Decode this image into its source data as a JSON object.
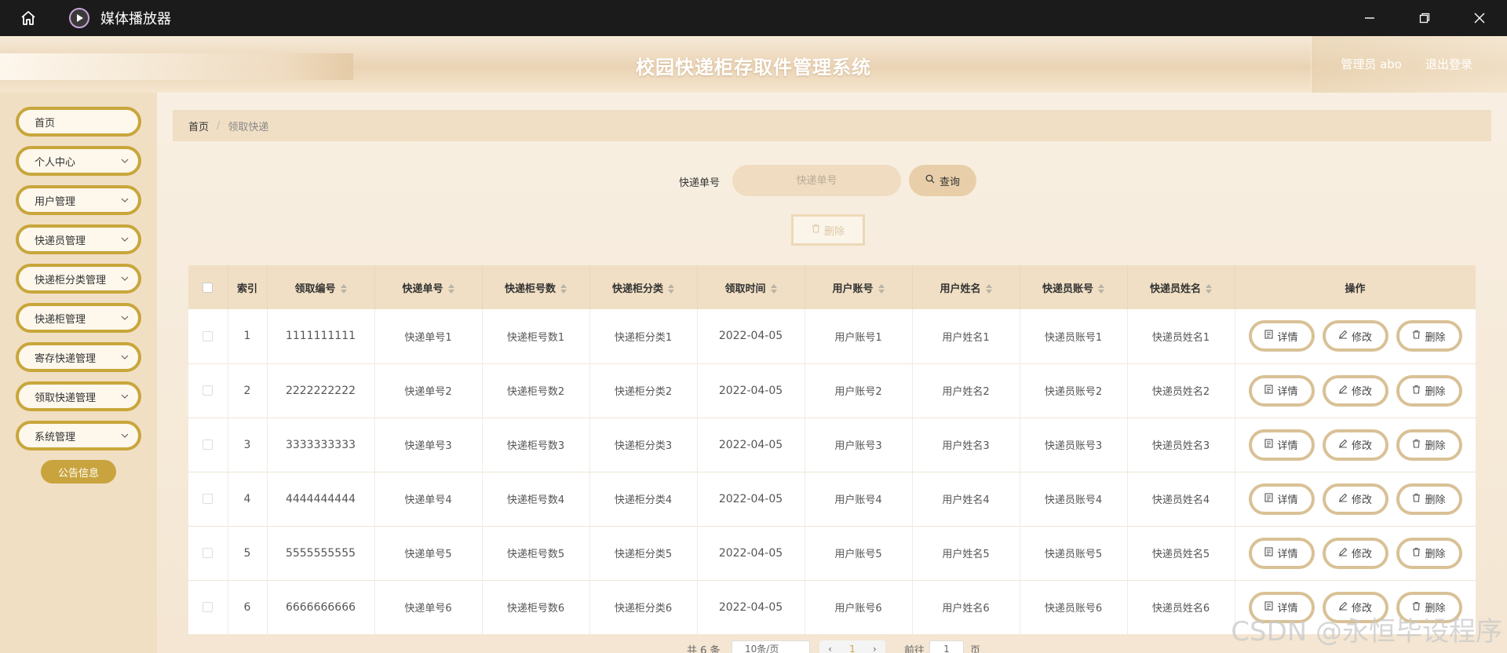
{
  "window": {
    "title": "媒体播放器"
  },
  "header": {
    "title": "校园快递柜存取件管理系统",
    "user": "管理员 abo",
    "logout": "退出登录"
  },
  "sidebar": {
    "items": [
      {
        "label": "首页",
        "has_arrow": false
      },
      {
        "label": "个人中心",
        "has_arrow": true
      },
      {
        "label": "用户管理",
        "has_arrow": true
      },
      {
        "label": "快递员管理",
        "has_arrow": true
      },
      {
        "label": "快递柜分类管理",
        "has_arrow": true
      },
      {
        "label": "快递柜管理",
        "has_arrow": true
      },
      {
        "label": "寄存快递管理",
        "has_arrow": true
      },
      {
        "label": "领取快递管理",
        "has_arrow": true
      },
      {
        "label": "系统管理",
        "has_arrow": true
      }
    ],
    "notice": "公告信息"
  },
  "breadcrumb": {
    "home": "首页",
    "separator": "/",
    "current": "领取快递"
  },
  "search": {
    "label": "快递单号",
    "placeholder": "快递单号",
    "query_label": "查询"
  },
  "batch_delete": "删除",
  "table": {
    "columns": [
      "索引",
      "领取编号",
      "快递单号",
      "快递柜号数",
      "快递柜分类",
      "领取时间",
      "用户账号",
      "用户姓名",
      "快递员账号",
      "快递员姓名",
      "操作"
    ],
    "rows": [
      [
        "1",
        "1111111111",
        "快递单号1",
        "快递柜号数1",
        "快递柜分类1",
        "2022-04-05",
        "用户账号1",
        "用户姓名1",
        "快递员账号1",
        "快递员姓名1"
      ],
      [
        "2",
        "2222222222",
        "快递单号2",
        "快递柜号数2",
        "快递柜分类2",
        "2022-04-05",
        "用户账号2",
        "用户姓名2",
        "快递员账号2",
        "快递员姓名2"
      ],
      [
        "3",
        "3333333333",
        "快递单号3",
        "快递柜号数3",
        "快递柜分类3",
        "2022-04-05",
        "用户账号3",
        "用户姓名3",
        "快递员账号3",
        "快递员姓名3"
      ],
      [
        "4",
        "4444444444",
        "快递单号4",
        "快递柜号数4",
        "快递柜分类4",
        "2022-04-05",
        "用户账号4",
        "用户姓名4",
        "快递员账号4",
        "快递员姓名4"
      ],
      [
        "5",
        "5555555555",
        "快递单号5",
        "快递柜号数5",
        "快递柜分类5",
        "2022-04-05",
        "用户账号5",
        "用户姓名5",
        "快递员账号5",
        "快递员姓名5"
      ],
      [
        "6",
        "6666666666",
        "快递单号6",
        "快递柜号数6",
        "快递柜分类6",
        "2022-04-05",
        "用户账号6",
        "用户姓名6",
        "快递员账号6",
        "快递员姓名6"
      ]
    ],
    "actions": [
      "详情",
      "修改",
      "删除"
    ]
  },
  "pagination": {
    "total": "共 6 条",
    "page_size": "10条/页",
    "current": "1",
    "goto_label": "前往",
    "goto_value": "1",
    "page_unit": "页"
  },
  "watermark": "CSDN @永恒毕设程序",
  "colors": {
    "accent": "#c9a43e",
    "header_bg": "#ead3b4",
    "sidebar_bg": "#f1dfc4",
    "table_head": "#f0dfc4"
  }
}
